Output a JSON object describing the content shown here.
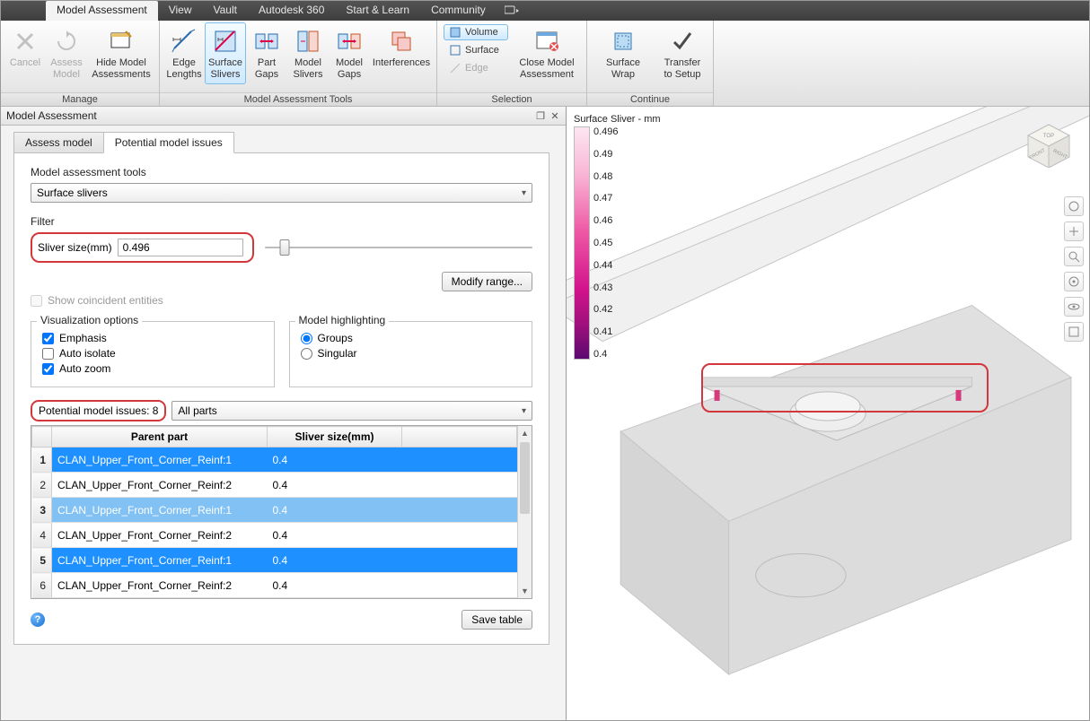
{
  "menubar": {
    "tabs": [
      "Model Assessment",
      "View",
      "Vault",
      "Autodesk 360",
      "Start & Learn",
      "Community"
    ],
    "active_index": 0
  },
  "ribbon": {
    "groups": [
      {
        "label": "Manage",
        "items": [
          {
            "label": "Cancel",
            "icon": "x-icon",
            "disabled": true
          },
          {
            "label": "Assess\nModel",
            "icon": "refresh-icon",
            "disabled": true
          },
          {
            "label": "Hide Model\nAssessments",
            "icon": "rect-icon"
          }
        ]
      },
      {
        "label": "Model Assessment Tools",
        "items": [
          {
            "label": "Edge\nLengths",
            "icon": "edge-icon"
          },
          {
            "label": "Surface\nSlivers",
            "icon": "sliver-icon",
            "active": true
          },
          {
            "label": "Part\nGaps",
            "icon": "gap-icon"
          },
          {
            "label": "Model\nSlivers",
            "icon": "sliver2-icon"
          },
          {
            "label": "Model\nGaps",
            "icon": "gap2-icon"
          },
          {
            "label": "Interferences",
            "icon": "interf-icon"
          }
        ]
      },
      {
        "label": "Selection",
        "small": [
          {
            "label": "Volume",
            "active": true,
            "icon": "volume-icon"
          },
          {
            "label": "Surface",
            "icon": "surface-icon"
          },
          {
            "label": "Edge",
            "disabled": true,
            "icon": "edge2-icon"
          }
        ],
        "items": [
          {
            "label": "Close Model\nAssessment",
            "icon": "close-panel-icon"
          }
        ]
      },
      {
        "label": "Continue",
        "items": [
          {
            "label": "Surface Wrap",
            "icon": "wrap-icon"
          },
          {
            "label": "Transfer\nto Setup",
            "icon": "check-icon"
          }
        ]
      }
    ]
  },
  "panel": {
    "title": "Model Assessment",
    "tabs": {
      "items": [
        "Assess model",
        "Potential model issues"
      ],
      "active_index": 1
    },
    "tools_label": "Model assessment tools",
    "tools_value": "Surface slivers",
    "filter_label": "Filter",
    "sliver_size_label": "Sliver size(mm)",
    "sliver_size_value": "0.496",
    "modify_range_btn": "Modify range...",
    "coincident_label": "Show coincident entities",
    "coincident_checked": false,
    "viz_title": "Visualization options",
    "viz": [
      {
        "label": "Emphasis",
        "checked": true
      },
      {
        "label": "Auto isolate",
        "checked": false
      },
      {
        "label": "Auto zoom",
        "checked": true
      }
    ],
    "highlight_title": "Model highlighting",
    "highlight": [
      {
        "label": "Groups",
        "checked": true
      },
      {
        "label": "Singular",
        "checked": false
      }
    ],
    "issues_label": "Potential model issues: 8",
    "parts_filter": "All parts",
    "columns": [
      "Parent part",
      "Sliver size(mm)"
    ],
    "rows": [
      {
        "n": "1",
        "part": "CLAN_Upper_Front_Corner_Reinf:1",
        "size": "0.4",
        "sel": "sel"
      },
      {
        "n": "2",
        "part": "CLAN_Upper_Front_Corner_Reinf:2",
        "size": "0.4"
      },
      {
        "n": "3",
        "part": "CLAN_Upper_Front_Corner_Reinf:1",
        "size": "0.4",
        "sel": "sel2"
      },
      {
        "n": "4",
        "part": "CLAN_Upper_Front_Corner_Reinf:2",
        "size": "0.4"
      },
      {
        "n": "5",
        "part": "CLAN_Upper_Front_Corner_Reinf:1",
        "size": "0.4",
        "sel": "sel"
      },
      {
        "n": "6",
        "part": "CLAN_Upper_Front_Corner_Reinf:2",
        "size": "0.4"
      }
    ],
    "save_btn": "Save table"
  },
  "viewport": {
    "legend_title": "Surface Sliver - mm",
    "legend_ticks": [
      "0.496",
      "0.49",
      "0.48",
      "0.47",
      "0.46",
      "0.45",
      "0.44",
      "0.43",
      "0.42",
      "0.41",
      "0.4"
    ],
    "viewcube_faces": {
      "top": "TOP",
      "front": "FRONT",
      "right": "RIGHT"
    }
  }
}
